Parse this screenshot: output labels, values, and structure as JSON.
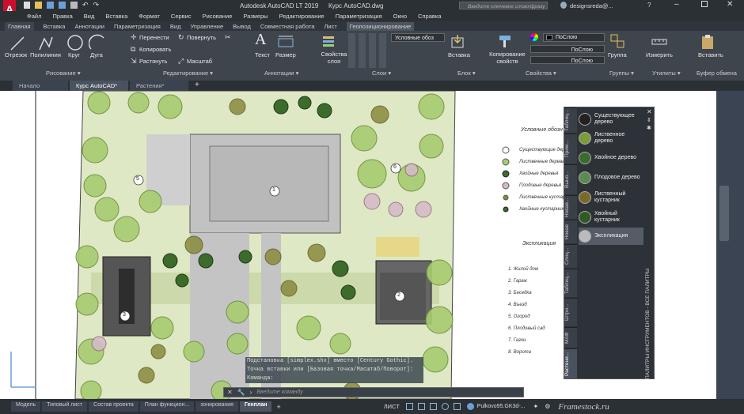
{
  "titlebar": {
    "app_title": "Autodesk AutoCAD LT 2019",
    "file_title": "Курс AutoCAD.dwg",
    "search_placeholder": "Введите ключевое слово/фразу",
    "user": "designsreda@..."
  },
  "menu": [
    "Файл",
    "Правка",
    "Вид",
    "Вставка",
    "Формат",
    "Сервис",
    "Рисование",
    "Размеры",
    "Редактирование",
    "Параметризация",
    "Окно",
    "Справка"
  ],
  "ribbon_tabs": [
    "Главная",
    "Вставка",
    "Аннотации",
    "Параметризация",
    "Вид",
    "Управление",
    "Вывод",
    "Совместная работа",
    "Лист",
    "Геопозиционирование"
  ],
  "ribbon": {
    "draw": {
      "line": "Отрезок",
      "polyline": "Полилиния",
      "circle": "Круг",
      "arc": "Дуга",
      "header": "Рисование ▾"
    },
    "edit": {
      "move": "Перенести",
      "rotate": "Повернуть",
      "copy": "Копировать",
      "stretch": "Растянуть",
      "scale": "Масштаб",
      "header": "Редактирование ▾"
    },
    "annot": {
      "text": "Текст",
      "dim": "Размер",
      "header": "Аннотации ▾"
    },
    "layers": {
      "props": "Свойства слоя",
      "header": "Слои ▾",
      "current": "Условные обоз"
    },
    "block": {
      "insert": "Вставка",
      "header": "Блок ▾"
    },
    "props": {
      "copy": "Копирование свойств",
      "bylayer1": "ПоСлою",
      "bylayer2": "ПоСлою",
      "bylayer3": "ПоСлою",
      "header": "Свойства ▾"
    },
    "groups": {
      "group": "Группа",
      "header": "Группы ▾"
    },
    "utils": {
      "measure": "Измерить",
      "header": "Утилиты ▾"
    },
    "clipboard": {
      "paste": "Вставить",
      "header": "Буфер обмена"
    }
  },
  "doc_tabs": [
    "Начало",
    "Курс AutoCAD*",
    "Растения*"
  ],
  "legend": {
    "title": "Условные обозн",
    "items": [
      "Существующие деревья",
      "Лиственные деревья",
      "Хвойные деревья",
      "Плодовые деревья",
      "Лиственные кустарники",
      "Хвойные кустарники"
    ],
    "expl_title": "Экспликация",
    "expl": [
      "1. Жилой дом",
      "2. Гараж",
      "3. Беседка",
      "4. Въезд",
      "5. Огород",
      "6. Плодовый сад",
      "7. Газон",
      "8. Ворота"
    ]
  },
  "plan_labels": [
    "1",
    "2",
    "3",
    "5",
    "6"
  ],
  "palette": {
    "tabs": [
      "Таблиц...",
      "Прим...",
      "Выно...",
      "Новая...",
      "Новая",
      "Слиц...",
      "Таблиц...",
      "Штри...",
      "МАФ",
      "Растени..."
    ],
    "items": [
      "Существующее дерево",
      "Лиственное дерево",
      "Хвойное дерево",
      "Плодовое дерево",
      "Лиственный кустарник",
      "Хвойный кустарник",
      "Экспликация"
    ],
    "title": "ПАЛИТРЫ ИНСТРУМЕНТОВ - ВСЕ ПАЛИТРЫ"
  },
  "command": {
    "lines": [
      "Подстановка [simplex.shx] вместо [Century Gothic].",
      "Точка вставки или [Базовая точка/Масштаб/Поворот]:",
      "Команда:"
    ],
    "placeholder": "Введите команду"
  },
  "layout_tabs": [
    "Модель",
    "Типовый лист",
    "Состав проекта",
    "План функцион...",
    "зонирования",
    "Генплан"
  ],
  "status": {
    "space": "ЛИСТ",
    "coords": "Pulkovo95.GK3d-...",
    "watermark": "Framestock.ru"
  }
}
